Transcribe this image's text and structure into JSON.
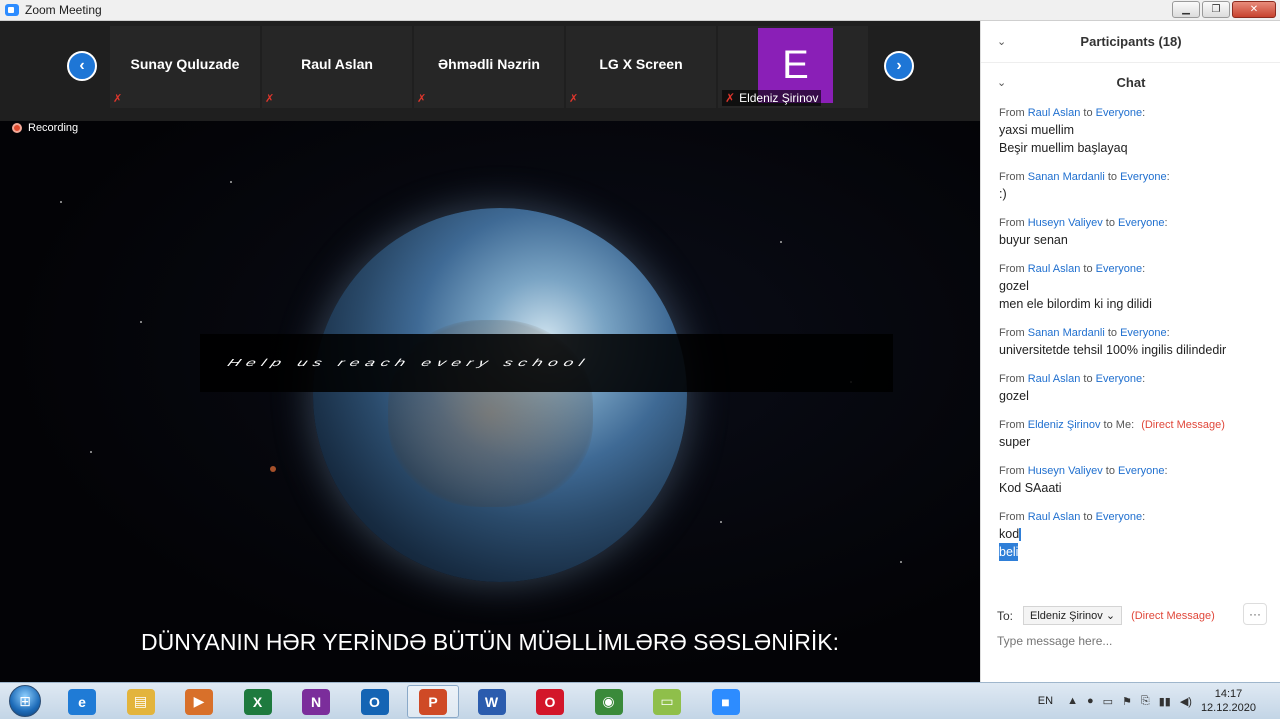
{
  "window": {
    "title": "Zoom Meeting",
    "minimize": "▁",
    "maximize": "❐",
    "close": "✕"
  },
  "strip": {
    "prev": "‹",
    "next": "›",
    "participants": [
      "Sunay Quluzade",
      "Raul Aslan",
      "Əhmədli Nəzrin",
      "LG X Screen"
    ],
    "mute_glyph": "🎤̸",
    "avatar_letter": "E",
    "avatar_name": "Eldeniz Şirinov"
  },
  "recording": "Recording",
  "video": {
    "banner_text": "Help us reach every school",
    "caption": "DÜNYANIN HƏR YERİNDƏ BÜTÜN MÜƏLLİMLƏRƏ SƏSLƏNİRİK:"
  },
  "panel": {
    "participants_header": "Participants (18)",
    "chat_header": "Chat",
    "chevron": "⌄",
    "messages": [
      {
        "from": "Raul Aslan",
        "to": "Everyone",
        "lines": [
          "yaxsi muellim",
          "Beşir muellim başlayaq"
        ]
      },
      {
        "from": "Sanan Mardanli",
        "to": "Everyone",
        "lines": [
          ":)"
        ]
      },
      {
        "from": "Huseyn Valiyev",
        "to": "Everyone",
        "lines": [
          "buyur senan"
        ]
      },
      {
        "from": "Raul Aslan",
        "to": "Everyone",
        "lines": [
          "gozel",
          "men ele bilordim ki ing dilidi"
        ]
      },
      {
        "from": "Sanan Mardanli",
        "to": "Everyone",
        "lines": [
          "universitetde tehsil 100% ingilis dilindedir"
        ]
      },
      {
        "from": "Raul Aslan",
        "to": "Everyone",
        "lines": [
          "gozel"
        ]
      },
      {
        "from": "Eldeniz Şirinov",
        "to": "Me",
        "dm": "(Direct Message)",
        "lines": [
          "super"
        ]
      },
      {
        "from": "Huseyn Valiyev",
        "to": "Everyone",
        "lines": [
          "Kod SAaati"
        ]
      },
      {
        "from": "Raul Aslan",
        "to": "Everyone",
        "lines": [
          "kod",
          "beli"
        ]
      }
    ],
    "to_label": "To:",
    "to_value": "Eldeniz Şirinov",
    "to_dm": "(Direct Message)",
    "more": "···",
    "input_placeholder": "Type message here..."
  },
  "taskbar": {
    "start": "⊞",
    "apps": [
      {
        "name": "ie",
        "glyph": "e",
        "color": "#1f7bd6"
      },
      {
        "name": "explorer",
        "glyph": "▤",
        "color": "#e3b43c"
      },
      {
        "name": "media",
        "glyph": "▶",
        "color": "#d8702a"
      },
      {
        "name": "excel",
        "glyph": "X",
        "color": "#1e7a3e"
      },
      {
        "name": "onenote",
        "glyph": "N",
        "color": "#7b2d9b"
      },
      {
        "name": "outlook",
        "glyph": "O",
        "color": "#1464b4"
      },
      {
        "name": "powerpoint",
        "glyph": "P",
        "color": "#cf4a26"
      },
      {
        "name": "word",
        "glyph": "W",
        "color": "#2b5cae"
      },
      {
        "name": "opera",
        "glyph": "O",
        "color": "#d3162a"
      },
      {
        "name": "chrome",
        "glyph": "◉",
        "color": "#3a8a3a"
      },
      {
        "name": "sticky-notes",
        "glyph": "▭",
        "color": "#8fbf4a"
      },
      {
        "name": "zoom",
        "glyph": "■",
        "color": "#2d8cff"
      }
    ],
    "lang": "EN",
    "tray_icons": [
      "▲",
      "●",
      "▭",
      "⚑",
      "⎘",
      "▮▮",
      "◀)"
    ],
    "time": "14:17",
    "date": "12.12.2020"
  }
}
